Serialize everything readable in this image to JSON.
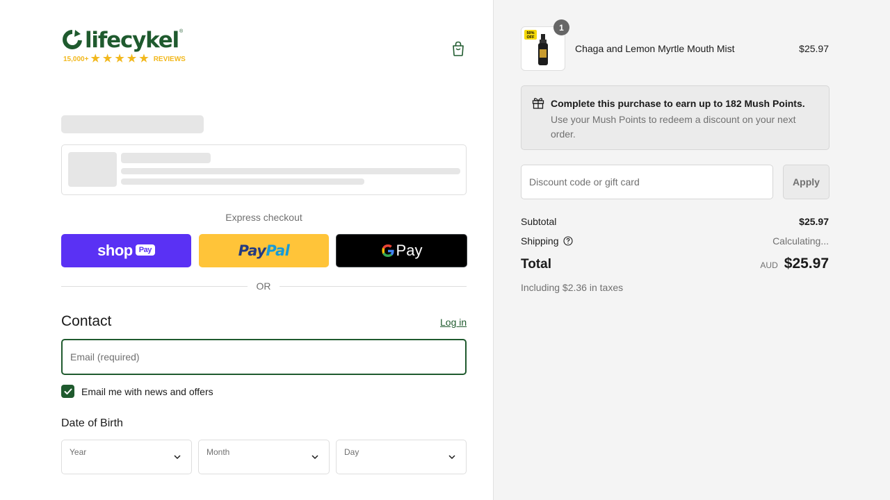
{
  "brand": {
    "name": "lifecykel",
    "reviews_count": "15,000+",
    "reviews_label": "REVIEWS",
    "stars": "★★★★★",
    "registered_mark": "®"
  },
  "express": {
    "label": "Express checkout",
    "shop_label": "shop",
    "shop_pay_label": "Pay",
    "paypal_label_1": "Pay",
    "paypal_label_2": "Pal",
    "gpay_label": "Pay"
  },
  "divider_text": "OR",
  "contact": {
    "title": "Contact",
    "login_label": "Log in",
    "email_placeholder": "Email (required)",
    "newsletter_label": "Email me with news and offers",
    "newsletter_checked": true
  },
  "dob": {
    "title": "Date of Birth",
    "year_label": "Year",
    "month_label": "Month",
    "day_label": "Day"
  },
  "order": {
    "item_quantity": "1",
    "item_name": "Chaga and Lemon Myrtle Mouth Mist",
    "item_price": "$25.97",
    "item_badge": "50% OFF"
  },
  "points": {
    "title": "Complete this purchase to earn up to 182 Mush Points.",
    "description": "Use your Mush Points to redeem a discount on your next order."
  },
  "discount": {
    "placeholder": "Discount code or gift card",
    "apply_label": "Apply"
  },
  "summary": {
    "subtotal_label": "Subtotal",
    "subtotal_value": "$25.97",
    "shipping_label": "Shipping",
    "shipping_value": "Calculating...",
    "total_label": "Total",
    "currency": "AUD",
    "total_value": "$25.97",
    "taxes_note": "Including $2.36 in taxes"
  },
  "colors": {
    "brand_green": "#1f5a2e",
    "shop_purple": "#5a31f4",
    "paypal_yellow": "#ffc439",
    "star_yellow": "#f2b81d"
  }
}
